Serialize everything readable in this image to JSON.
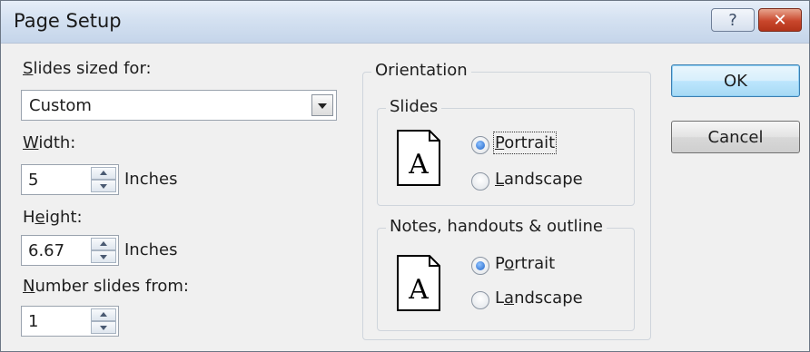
{
  "window": {
    "title": "Page Setup",
    "help_label": "?",
    "close_label": "✕"
  },
  "slides_sized_for": {
    "label_u": "S",
    "label_rest": "lides sized for:",
    "value": "Custom"
  },
  "width": {
    "label_u": "W",
    "label_rest": "idth:",
    "value": "5",
    "unit": "Inches"
  },
  "height": {
    "label_pre": "H",
    "label_u": "e",
    "label_rest": "ight:",
    "value": "6.67",
    "unit": "Inches"
  },
  "number_from": {
    "label_u": "N",
    "label_rest": "umber slides from:",
    "value": "1"
  },
  "orientation": {
    "legend": "Orientation",
    "slides": {
      "legend": "Slides",
      "portrait_u": "P",
      "portrait_rest": "ortrait",
      "landscape_u": "L",
      "landscape_rest": "andscape",
      "selected": "Portrait"
    },
    "notes": {
      "legend": "Notes, handouts & outline",
      "portrait_pre": "P",
      "portrait_u": "o",
      "portrait_rest": "rtrait",
      "landscape_pre": "L",
      "landscape_u": "a",
      "landscape_rest": "ndscape",
      "selected": "Portrait"
    },
    "page_glyph": "A"
  },
  "buttons": {
    "ok": "OK",
    "cancel": "Cancel"
  }
}
